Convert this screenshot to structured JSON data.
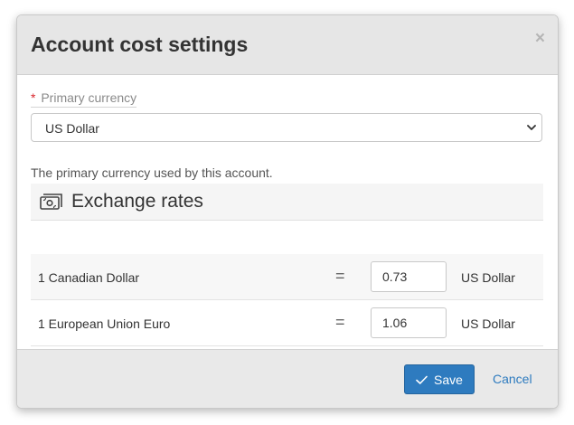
{
  "modal": {
    "title": "Account cost settings",
    "close_glyph": "×"
  },
  "primary_currency": {
    "required_marker": "*",
    "label": "Primary currency",
    "selected_value": "US Dollar",
    "help_text": "The primary currency used by this account."
  },
  "exchange_rates": {
    "title": "Exchange rates",
    "icon": "money-bill-icon",
    "equals_glyph": "=",
    "rows": [
      {
        "from": "1 Canadian Dollar",
        "value": "0.73",
        "to": "US Dollar"
      },
      {
        "from": "1 European Union Euro",
        "value": "1.06",
        "to": "US Dollar"
      }
    ]
  },
  "footer": {
    "save_label": "Save",
    "cancel_label": "Cancel"
  },
  "colors": {
    "primary": "#2e7bbf",
    "required": "#d9262c",
    "header_bg": "#e6e6e6"
  }
}
